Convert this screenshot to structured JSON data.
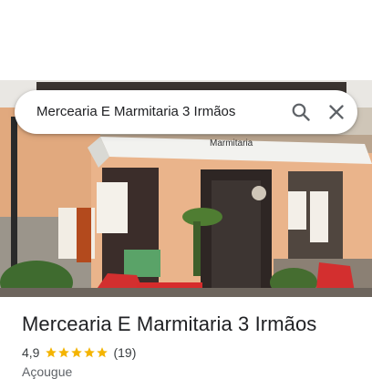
{
  "search": {
    "query": "Mercearia E Marmitaria 3 Irmãos",
    "search_icon": "search-icon",
    "close_icon": "close-icon"
  },
  "photo": {
    "storefront_sign_text": "Marmitaria"
  },
  "place": {
    "title": "Mercearia E Marmitaria 3 Irmãos",
    "rating": "4,9",
    "stars": 5,
    "review_count": "(19)",
    "category": "Açougue"
  },
  "colors": {
    "star": "#f4b400",
    "title_text": "#202124",
    "secondary_text": "#5f6368"
  }
}
